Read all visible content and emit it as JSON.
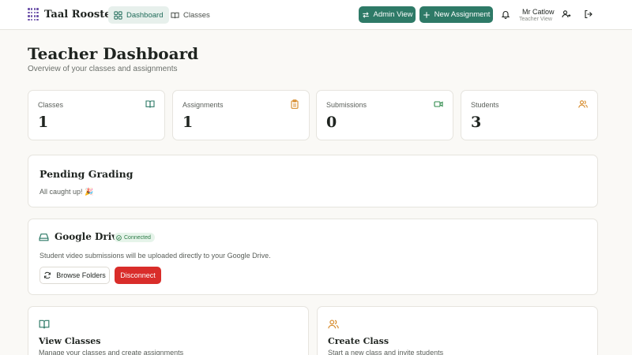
{
  "nav": {
    "brand": "Taal Rooster",
    "tabs": [
      {
        "label": "Dashboard",
        "icon": "grid-icon",
        "active": true
      },
      {
        "label": "Classes",
        "icon": "book-icon",
        "active": false
      }
    ],
    "admin_view_label": "Admin View",
    "new_assignment_label": "New Assignment",
    "user_name": "Mr Catlow",
    "user_role": "Teacher View"
  },
  "page": {
    "title": "Teacher Dashboard",
    "subtitle": "Overview of your classes and assignments"
  },
  "stats": [
    {
      "label": "Classes",
      "value": "1",
      "icon": "book-open-icon",
      "color": "#2e7a67"
    },
    {
      "label": "Assignments",
      "value": "1",
      "icon": "clipboard-icon",
      "color": "#d68a2a"
    },
    {
      "label": "Submissions",
      "value": "0",
      "icon": "video-icon",
      "color": "#2e8a4a"
    },
    {
      "label": "Students",
      "value": "3",
      "icon": "users-icon",
      "color": "#d68a2a"
    }
  ],
  "pending": {
    "title": "Pending Grading",
    "message": "All caught up! 🎉"
  },
  "drive": {
    "title": "Google Drive",
    "status": "Connected",
    "description": "Student video submissions will be uploaded directly to your Google Drive.",
    "browse_label": "Browse Folders",
    "disconnect_label": "Disconnect"
  },
  "actions": [
    {
      "title": "View Classes",
      "description": "Manage your classes and create assignments",
      "icon": "book-open-icon"
    },
    {
      "title": "Create Class",
      "description": "Start a new class and invite students",
      "icon": "users-icon"
    }
  ],
  "colors": {
    "accent": "#2e7a67",
    "danger": "#d92d2a",
    "brand_logo": "#6b4fa8"
  }
}
